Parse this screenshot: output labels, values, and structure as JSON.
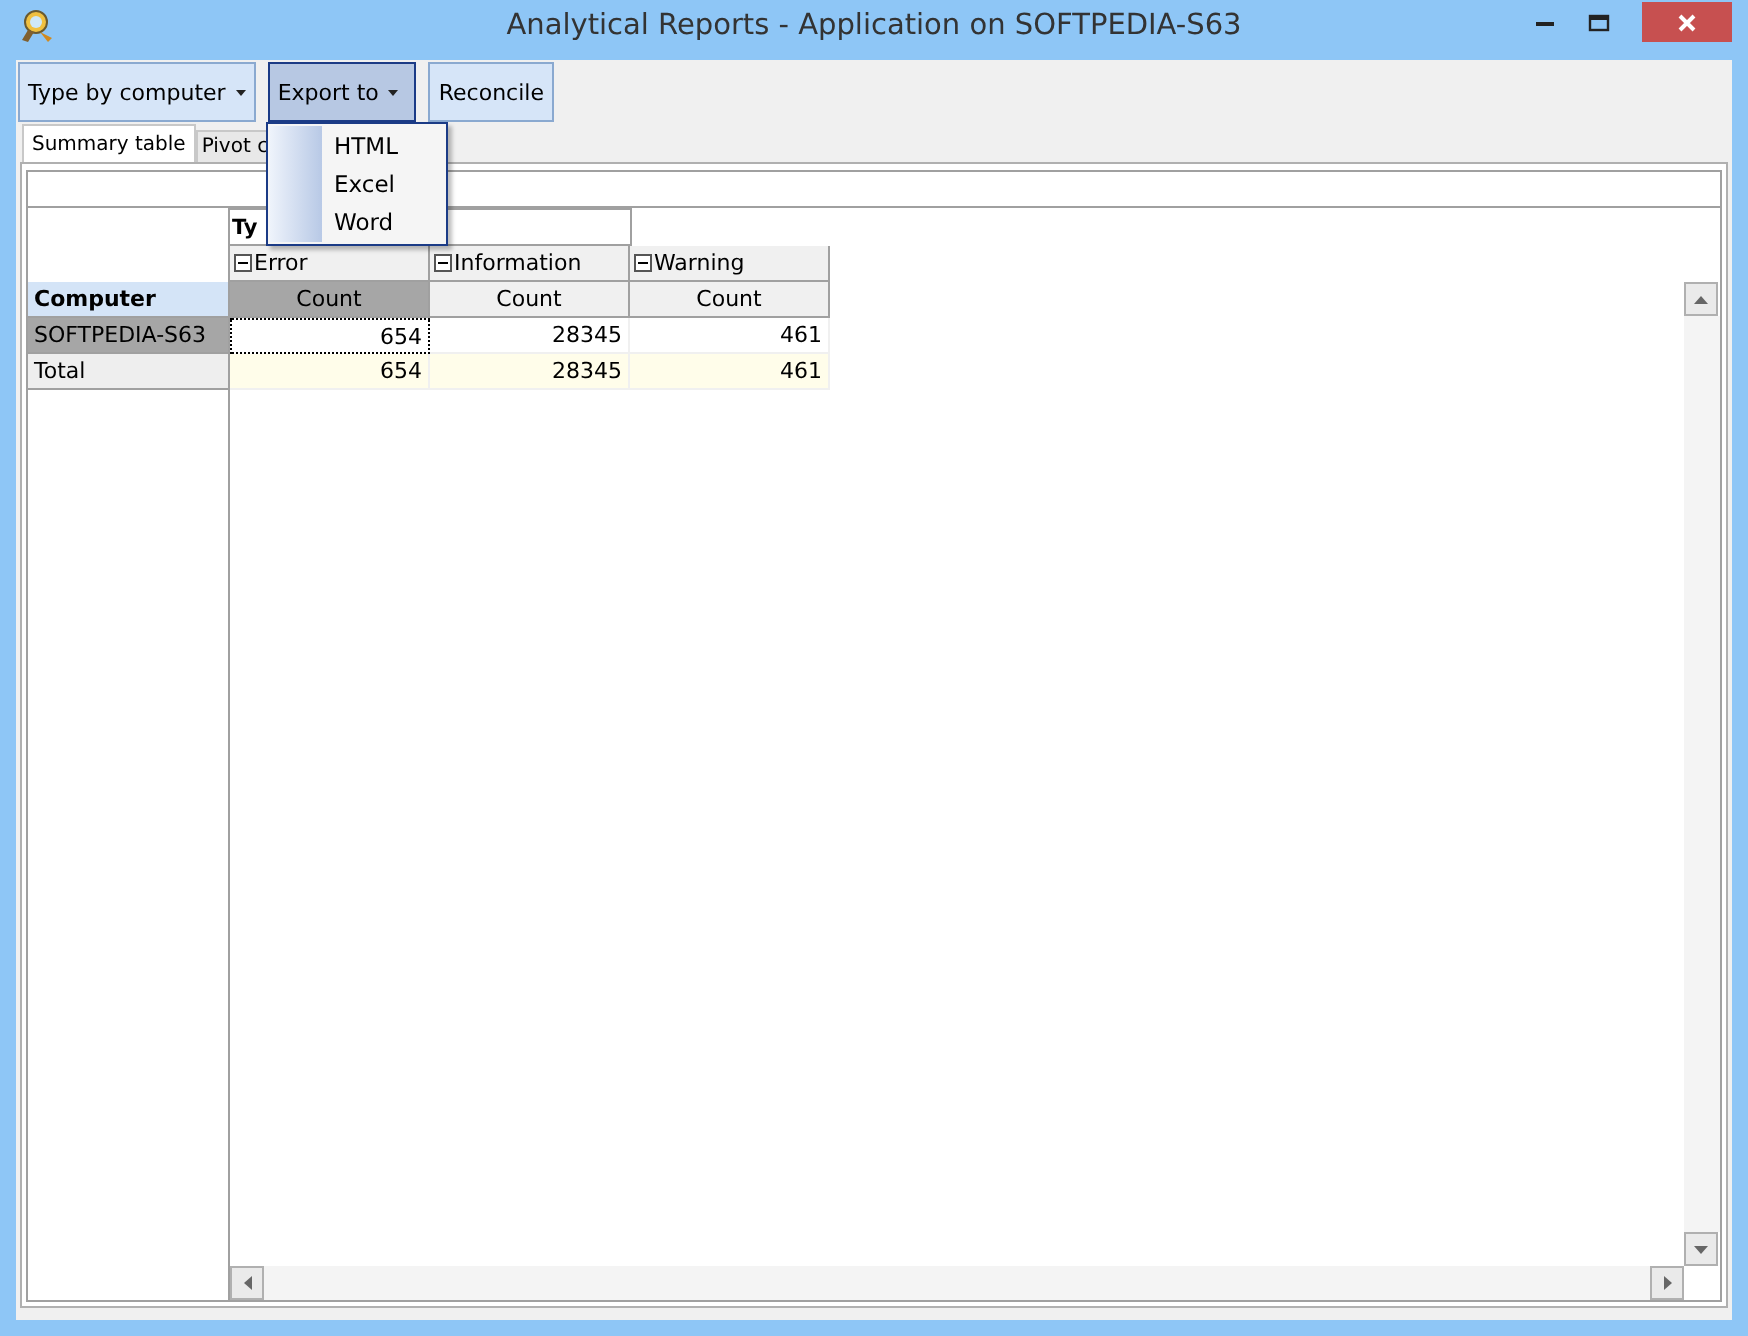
{
  "window": {
    "title": "Analytical Reports - Application on SOFTPEDIA-S63"
  },
  "toolbar": [
    {
      "label": "Type by computer",
      "kind": "dropdown",
      "selected": false
    },
    {
      "label": "Export to",
      "kind": "dropdown",
      "selected": true
    },
    {
      "label": "Reconcile",
      "kind": "button",
      "selected": false
    }
  ],
  "menu": {
    "items": [
      "HTML",
      "Excel",
      "Word"
    ]
  },
  "tabs": [
    {
      "label": "Summary table",
      "selected": true
    },
    {
      "label": "Pivot c",
      "selected": false
    }
  ],
  "pivot": {
    "column_field": "Ty",
    "row_field": "Computer",
    "columns": [
      {
        "label": "Error",
        "expanded": true,
        "measure": "Count",
        "selected": true
      },
      {
        "label": "Information",
        "expanded": true,
        "measure": "Count",
        "selected": false
      },
      {
        "label": "Warning",
        "expanded": true,
        "measure": "Count",
        "selected": false
      }
    ],
    "rows": [
      {
        "label": "SOFTPEDIA-S63",
        "kind": "item",
        "selected": true,
        "values": [
          "654",
          "28345",
          "461"
        ]
      },
      {
        "label": "Total",
        "kind": "total",
        "selected": false,
        "values": [
          "654",
          "28345",
          "461"
        ]
      }
    ]
  }
}
